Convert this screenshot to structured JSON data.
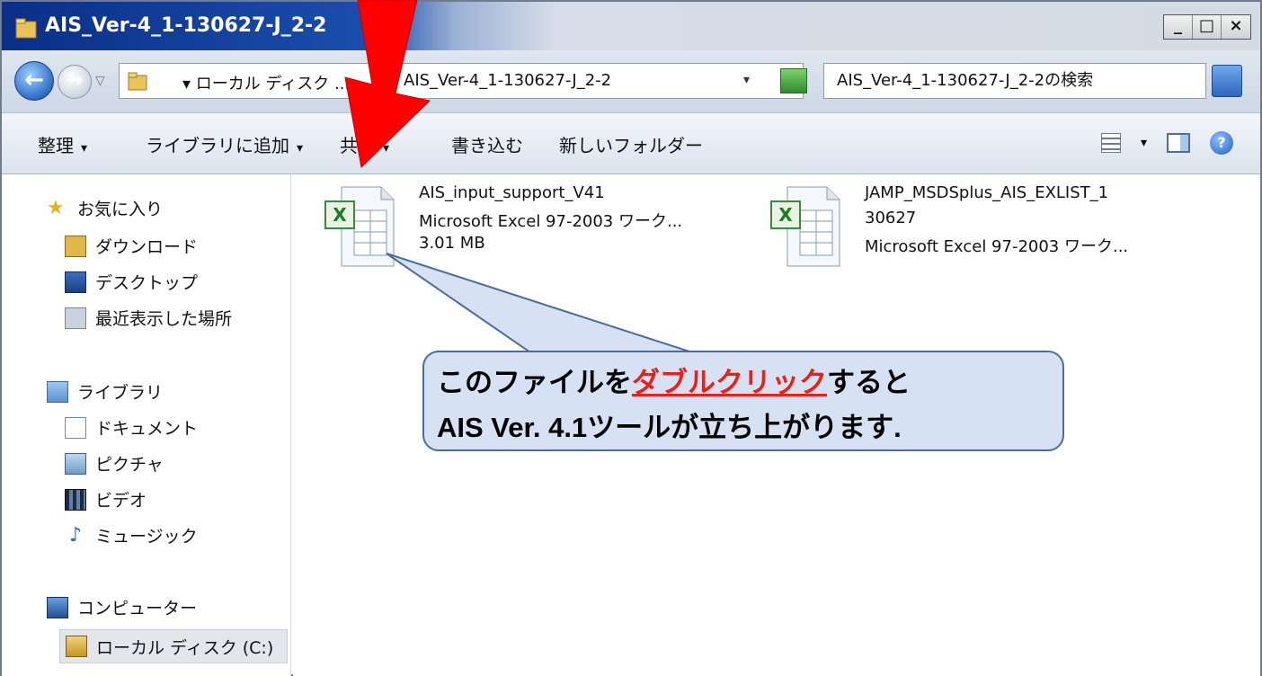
{
  "window": {
    "title": "AIS_Ver-4_1-130627-J_2-2",
    "controls": {
      "minimize": "_",
      "maximize": "□",
      "close": "×"
    }
  },
  "address_bar": {
    "crumb_drive": "▾ ローカル ディスク ...",
    "crumb_folder": "AIS_Ver-4_1-130627-J_2-2",
    "dropdown": "▾",
    "search_placeholder": "AIS_Ver-4_1-130627-J_2-2の検索"
  },
  "toolbar": {
    "organize": "整理",
    "add_to_library": "ライブラリに追加",
    "share": "共有",
    "burn": "書き込む",
    "new_folder": "新しいフォルダー",
    "caret": "▾",
    "help": "?"
  },
  "nav": {
    "favorites": {
      "header": "お気に入り",
      "items": [
        "ダウンロード",
        "デスクトップ",
        "最近表示した場所"
      ]
    },
    "libraries": {
      "header": "ライブラリ",
      "items": [
        "ドキュメント",
        "ピクチャ",
        "ビデオ",
        "ミュージック"
      ]
    },
    "computer": {
      "header": "コンピューター",
      "items": [
        "ローカル ディスク (C:)"
      ]
    }
  },
  "files": [
    {
      "name": "AIS_input_support_V41",
      "type": "Microsoft Excel 97-2003 ワーク...",
      "size": "3.01 MB",
      "icon": "excel-icon"
    },
    {
      "name_line1": "JAMP_MSDSplus_AIS_EXLIST_1",
      "name_line2": "30627",
      "type": "Microsoft Excel 97-2003 ワーク...",
      "icon": "excel-icon"
    }
  ],
  "callout": {
    "line1_prefix": "このファイルを",
    "line1_emphasis": "ダブルクリック",
    "line1_suffix": "すると",
    "line2": "AIS Ver. 4.1ツールが立ち上がります."
  },
  "colors": {
    "arrow": "#ff0000",
    "callout_fill": "#d6e1f3",
    "emphasis": "#e8201a"
  }
}
